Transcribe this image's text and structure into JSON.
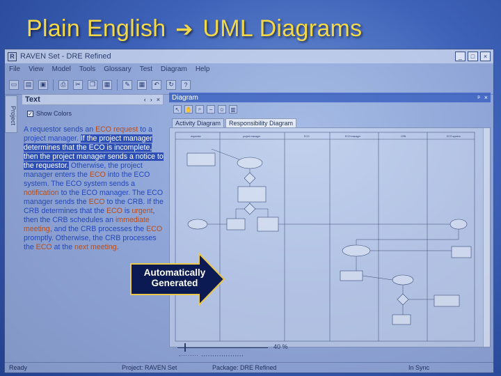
{
  "slide": {
    "title_left": "Plain English",
    "title_arrow": "➔",
    "title_right": "UML Diagrams"
  },
  "window": {
    "title": "RAVEN Set - DRE Refined",
    "buttons": [
      "_",
      "□",
      "×"
    ]
  },
  "menu": [
    "File",
    "View",
    "Model",
    "Tools",
    "Glossary",
    "Test",
    "Diagram",
    "Help"
  ],
  "left_panel": {
    "project_tab": "Project",
    "header": "Text",
    "header_buttons": [
      "‹",
      "›",
      "×"
    ],
    "show_colors_label": "Show Colors",
    "requirement": [
      {
        "t": "A requestor sends an ",
        "c": "blue"
      },
      {
        "t": "ECO request",
        "c": "orange"
      },
      {
        "t": " to a ",
        "c": "blue"
      },
      {
        "t": "project manager",
        "c": "blue"
      },
      {
        "t": ". ",
        "c": "blue"
      },
      {
        "t": "If the project manager determines that the ECO is incomplete, then the project manager sends a notice to the requestor.",
        "c": "sel"
      },
      {
        "t": " Otherwise, the ",
        "c": "blue"
      },
      {
        "t": "project manager",
        "c": "blue"
      },
      {
        "t": " enters the ",
        "c": "blue"
      },
      {
        "t": "ECO",
        "c": "orange"
      },
      {
        "t": " into the ",
        "c": "blue"
      },
      {
        "t": "ECO system",
        "c": "blue"
      },
      {
        "t": ". The ",
        "c": "blue"
      },
      {
        "t": "ECO system",
        "c": "blue"
      },
      {
        "t": " sends a ",
        "c": "blue"
      },
      {
        "t": "notification",
        "c": "orange"
      },
      {
        "t": " to the ",
        "c": "blue"
      },
      {
        "t": "ECO manager",
        "c": "blue"
      },
      {
        "t": ". The ",
        "c": "blue"
      },
      {
        "t": "ECO manager",
        "c": "blue"
      },
      {
        "t": " sends the ",
        "c": "blue"
      },
      {
        "t": "ECO",
        "c": "orange"
      },
      {
        "t": " to the ",
        "c": "blue"
      },
      {
        "t": "CRB",
        "c": "blue"
      },
      {
        "t": ". If the ",
        "c": "blue"
      },
      {
        "t": "CRB",
        "c": "blue"
      },
      {
        "t": " determines that the ",
        "c": "blue"
      },
      {
        "t": "ECO",
        "c": "orange"
      },
      {
        "t": " is ",
        "c": "blue"
      },
      {
        "t": "urgent",
        "c": "orange"
      },
      {
        "t": ", then the ",
        "c": "blue"
      },
      {
        "t": "CRB",
        "c": "blue"
      },
      {
        "t": " schedules an ",
        "c": "blue"
      },
      {
        "t": "immediate meeting",
        "c": "orange"
      },
      {
        "t": ", and the ",
        "c": "blue"
      },
      {
        "t": "CRB",
        "c": "blue"
      },
      {
        "t": " processes the ",
        "c": "blue"
      },
      {
        "t": "ECO",
        "c": "orange"
      },
      {
        "t": " promptly. Otherwise, the ",
        "c": "blue"
      },
      {
        "t": "CRB",
        "c": "blue"
      },
      {
        "t": " processes the ",
        "c": "blue"
      },
      {
        "t": "ECO",
        "c": "orange"
      },
      {
        "t": " at the ",
        "c": "blue"
      },
      {
        "t": "next meeting",
        "c": "orange"
      },
      {
        "t": ".",
        "c": "blue"
      }
    ]
  },
  "diagram_panel": {
    "header": "Diagram",
    "header_buttons": [
      "ᵖ",
      "×"
    ],
    "tabs": [
      "Activity Diagram",
      "Responsibility Diagram"
    ],
    "swimlanes": [
      "requestor",
      "project manager",
      "ECO",
      "ECO manager",
      "CRB",
      "ECO system"
    ],
    "zoom_label": "40 %"
  },
  "callout": {
    "line1": "Automatically",
    "line2": "Generated"
  },
  "status": {
    "ready": "Ready",
    "project": "Project: RAVEN Set",
    "package": "Package: DRE Refined",
    "sync": "In Sync"
  },
  "colors": {
    "title": "#f2d84a",
    "orange": "#b84c1a",
    "blue": "#2447b8",
    "selection": "#2d4fb6"
  },
  "icons": [
    "app-icon",
    "new-icon",
    "open-icon",
    "save-icon",
    "print-icon",
    "cut-icon",
    "copy-icon",
    "paste-icon",
    "undo-icon",
    "refresh-icon",
    "help-icon",
    "pointer-icon",
    "zoom-icon",
    "user-icon"
  ]
}
